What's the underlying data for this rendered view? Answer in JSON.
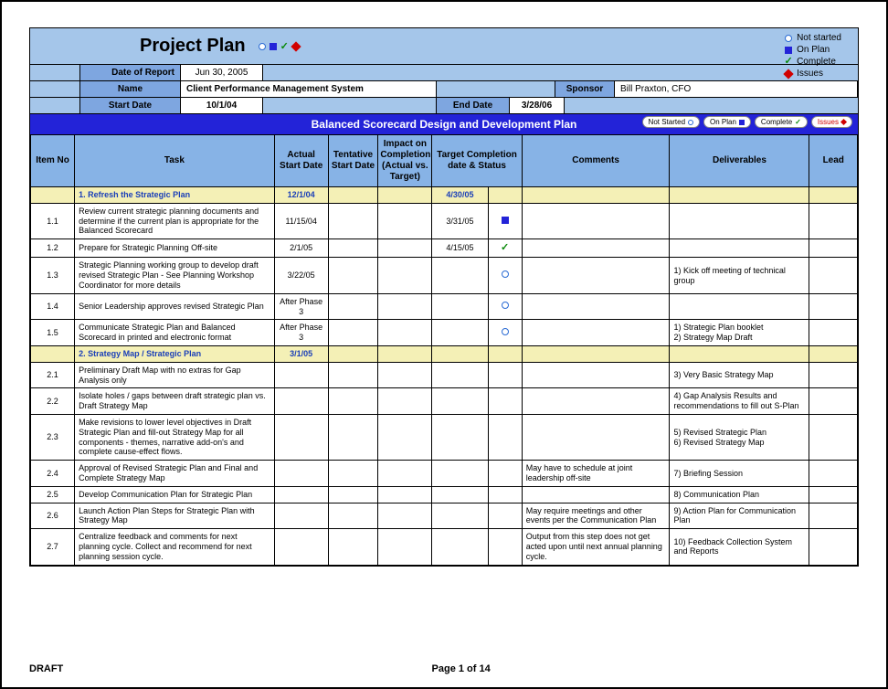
{
  "header": {
    "title": "Project Plan",
    "legend": {
      "not_started": "Not started",
      "on_plan": "On Plan",
      "complete": "Complete",
      "issues": "Issues"
    },
    "report_label": "Date of Report",
    "report_value": "Jun 30, 2005",
    "name_label": "Name",
    "name_value": "Client Performance Management System",
    "sponsor_label": "Sponsor",
    "sponsor_value": "Bill Praxton, CFO",
    "start_label": "Start Date",
    "start_value": "10/1/04",
    "end_label": "End Date",
    "end_value": "3/28/06"
  },
  "section_title": "Balanced Scorecard Design and Development Plan",
  "pills": {
    "not_started": "Not Started",
    "on_plan": "On Plan",
    "complete": "Complete",
    "issues": "Issues"
  },
  "columns": {
    "item": "Item No",
    "task": "Task",
    "ads": "Actual Start Date",
    "tsd": "Tentative Start Date",
    "impact": "Impact on Completion (Actual vs. Target)",
    "tcd": "Target Completion date & Status",
    "comments": "Comments",
    "deliverables": "Deliverables",
    "lead": "Lead"
  },
  "sections": [
    {
      "title": "1. Refresh the Strategic Plan",
      "date_ads": "12/1/04",
      "date_tcd": "4/30/05",
      "rows": [
        {
          "no": "1.1",
          "task": "Review current strategic planning documents and determine if the current plan is appropriate for the Balanced Scorecard",
          "ads": "11/15/04",
          "tsd": "",
          "imp": "",
          "tcd": "3/31/05",
          "status": "square",
          "comments": "",
          "deliv": "",
          "lead": ""
        },
        {
          "no": "1.2",
          "task": "Prepare for Strategic Planning Off-site",
          "ads": "2/1/05",
          "tsd": "",
          "imp": "",
          "tcd": "4/15/05",
          "status": "check",
          "comments": "",
          "deliv": "",
          "lead": ""
        },
        {
          "no": "1.3",
          "task": "Strategic Planning working group to develop draft revised Strategic Plan - See Planning Workshop Coordinator for more details",
          "ads": "3/22/05",
          "tsd": "",
          "imp": "",
          "tcd": "",
          "status": "circle",
          "comments": "",
          "deliv": "1) Kick off meeting of technical group",
          "lead": ""
        },
        {
          "no": "1.4",
          "task": "Senior Leadership approves revised Strategic Plan",
          "ads": "After Phase 3",
          "tsd": "",
          "imp": "",
          "tcd": "",
          "status": "circle",
          "comments": "",
          "deliv": "",
          "lead": ""
        },
        {
          "no": "1.5",
          "task": "Communicate Strategic Plan and Balanced Scorecard in printed and electronic format",
          "ads": "After Phase 3",
          "tsd": "",
          "imp": "",
          "tcd": "",
          "status": "circle",
          "comments": "",
          "deliv": "1) Strategic Plan booklet\n2) Strategy Map Draft",
          "lead": ""
        }
      ]
    },
    {
      "title": "2. Strategy Map / Strategic Plan",
      "date_ads": "3/1/05",
      "date_tcd": "",
      "rows": [
        {
          "no": "2.1",
          "task": "Preliminary Draft Map with no extras for Gap Analysis only",
          "ads": "",
          "tsd": "",
          "imp": "",
          "tcd": "",
          "status": "",
          "comments": "",
          "deliv": "3) Very Basic Strategy Map",
          "lead": ""
        },
        {
          "no": "2.2",
          "task": "Isolate holes / gaps between draft strategic plan vs. Draft Strategy Map",
          "ads": "",
          "tsd": "",
          "imp": "",
          "tcd": "",
          "status": "",
          "comments": "",
          "deliv": "4) Gap Analysis Results and recommendations to fill out S-Plan",
          "lead": ""
        },
        {
          "no": "2.3",
          "task": "Make revisions to lower level objectives in Draft Strategic Plan and fill-out Strategy Map for all components - themes, narrative add-on's and complete cause-effect flows.",
          "ads": "",
          "tsd": "",
          "imp": "",
          "tcd": "",
          "status": "",
          "comments": "",
          "deliv": "5) Revised Strategic Plan\n6) Revised Strategy Map",
          "lead": ""
        },
        {
          "no": "2.4",
          "task": "Approval of Revised Strategic Plan and Final and Complete Strategy Map",
          "ads": "",
          "tsd": "",
          "imp": "",
          "tcd": "",
          "status": "",
          "comments": "May have to schedule at joint leadership off-site",
          "deliv": "7) Briefing Session",
          "lead": ""
        },
        {
          "no": "2.5",
          "task": "Develop Communication Plan for Strategic Plan",
          "ads": "",
          "tsd": "",
          "imp": "",
          "tcd": "",
          "status": "",
          "comments": "",
          "deliv": "8) Communication Plan",
          "lead": ""
        },
        {
          "no": "2.6",
          "task": "Launch Action Plan Steps for Strategic Plan with Strategy Map",
          "ads": "",
          "tsd": "",
          "imp": "",
          "tcd": "",
          "status": "",
          "comments": "May require meetings and other events per the Communication Plan",
          "deliv": "9) Action Plan for Communication Plan",
          "lead": ""
        },
        {
          "no": "2.7",
          "task": "Centralize feedback and comments for next planning cycle. Collect and recommend for next planning session cycle.",
          "ads": "",
          "tsd": "",
          "imp": "",
          "tcd": "",
          "status": "",
          "comments": "Output from this step does not get acted upon until next annual planning cycle.",
          "deliv": "10) Feedback Collection System and Reports",
          "lead": ""
        }
      ]
    }
  ],
  "footer": {
    "left": "DRAFT",
    "center": "Page 1 of 14"
  }
}
